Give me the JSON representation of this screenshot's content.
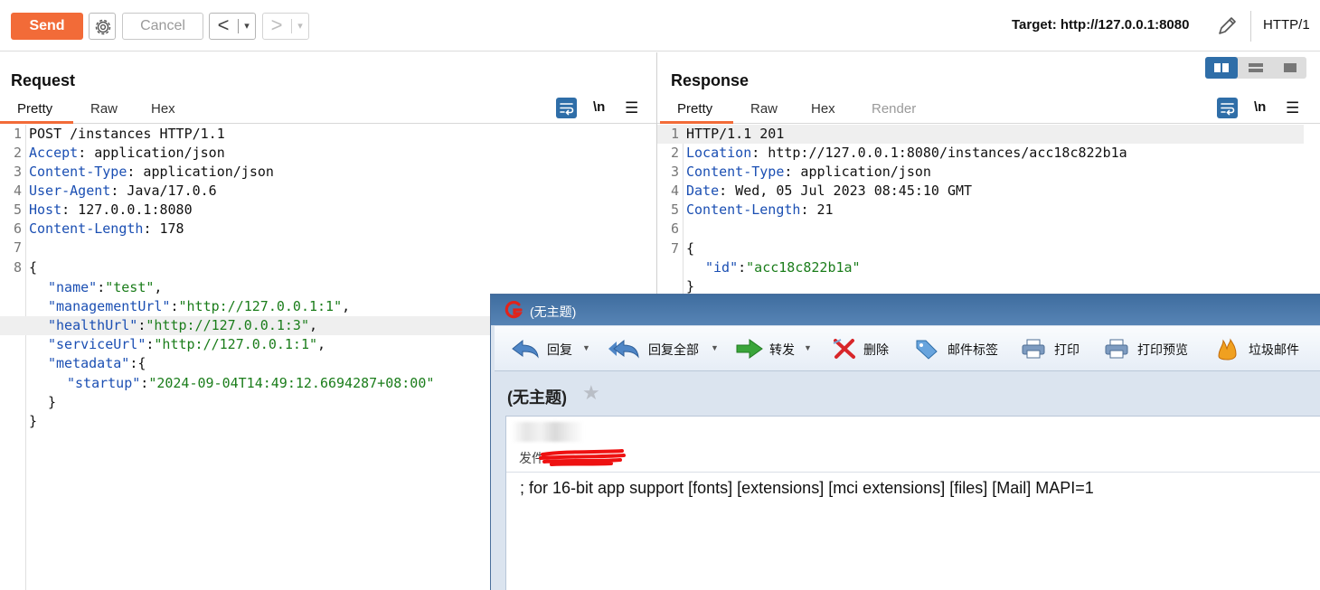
{
  "toolbar": {
    "send_label": "Send",
    "cancel_label": "Cancel",
    "back_arrow": "<",
    "forward_arrow": ">",
    "dropdown_caret": "▾",
    "target_label": "Target: http://127.0.0.1:8080",
    "http_version": "HTTP/1",
    "icons": [
      "gear-icon",
      "pencil-icon"
    ]
  },
  "request": {
    "title": "Request",
    "tabs": [
      "Pretty",
      "Raw",
      "Hex"
    ],
    "active_tab": "Pretty",
    "wrap_symbol": "\\n",
    "menu_symbol": "☰",
    "lines": [
      {
        "n": "1",
        "key": "",
        "rest": "POST /instances HTTP/1.1"
      },
      {
        "n": "2",
        "key": "Accept",
        "rest": ": application/json"
      },
      {
        "n": "3",
        "key": "Content-Type",
        "rest": ": application/json"
      },
      {
        "n": "4",
        "key": "User-Agent",
        "rest": ": Java/17.0.6"
      },
      {
        "n": "5",
        "key": "Host",
        "rest": ": 127.0.0.1:8080"
      },
      {
        "n": "6",
        "key": "Content-Length",
        "rest": ": 178"
      },
      {
        "n": "7",
        "key": "",
        "rest": ""
      },
      {
        "n": "8",
        "key": "",
        "rest": "{"
      }
    ],
    "json_lines": [
      {
        "k": "\"name\"",
        "sep": ":",
        "v": "\"test\"",
        "tail": ","
      },
      {
        "k": "\"managementUrl\"",
        "sep": ":",
        "v": "\"http://127.0.0.1:1\"",
        "tail": ","
      },
      {
        "k": "\"healthUrl\"",
        "sep": ":",
        "v": "\"http://127.0.0.1:3\"",
        "tail": ","
      },
      {
        "k": "\"serviceUrl\"",
        "sep": ":",
        "v": "\"http://127.0.0.1:1\"",
        "tail": ","
      },
      {
        "k": "\"metadata\"",
        "sep": ":{",
        "v": "",
        "tail": ""
      },
      {
        "k": "\"startup\"",
        "sep": ":",
        "v": "\"2024-09-04T14:49:12.6694287+08:00\"",
        "tail": ""
      },
      {
        "k": "",
        "sep": "}",
        "v": "",
        "tail": ""
      },
      {
        "k": "",
        "sep": "}",
        "v": "",
        "tail": ""
      }
    ]
  },
  "response": {
    "title": "Response",
    "tabs": [
      "Pretty",
      "Raw",
      "Hex",
      "Render"
    ],
    "active_tab": "Pretty",
    "wrap_symbol": "\\n",
    "menu_symbol": "☰",
    "lines": [
      {
        "n": "1",
        "key": "",
        "rest": "HTTP/1.1 201"
      },
      {
        "n": "2",
        "key": "Location",
        "rest": ": http://127.0.0.1:8080/instances/acc18c822b1a"
      },
      {
        "n": "3",
        "key": "Content-Type",
        "rest": ": application/json"
      },
      {
        "n": "4",
        "key": "Date",
        "rest": ": Wed, 05 Jul 2023 08:45:10 GMT"
      },
      {
        "n": "5",
        "key": "Content-Length",
        "rest": ": 21"
      },
      {
        "n": "6",
        "key": "",
        "rest": ""
      },
      {
        "n": "7",
        "key": "",
        "rest": "{"
      }
    ],
    "json_lines": [
      {
        "k": "\"id\"",
        "sep": ":",
        "v": "\"acc18c822b1a\"",
        "tail": ""
      },
      {
        "k": "",
        "sep": "}",
        "v": "",
        "tail": ""
      }
    ]
  },
  "mail": {
    "window_title": "(无主题)",
    "toolbar": [
      {
        "label": "回复",
        "icon": "reply-icon",
        "caret": true
      },
      {
        "label": "回复全部",
        "icon": "reply-all-icon",
        "caret": true
      },
      {
        "label": "转发",
        "icon": "forward-icon",
        "caret": true
      },
      {
        "label": "删除",
        "icon": "delete-icon",
        "caret": false
      },
      {
        "label": "邮件标签",
        "icon": "tag-icon",
        "caret": false
      },
      {
        "label": "打印",
        "icon": "print-icon",
        "caret": false
      },
      {
        "label": "打印预览",
        "icon": "print-preview-icon",
        "caret": false
      },
      {
        "label": "垃圾邮件",
        "icon": "spam-icon",
        "caret": false
      }
    ],
    "subject": "(无主题)",
    "star": "★",
    "from_label": "发件",
    "body_text": "; for 16-bit app support [fonts] [extensions] [mci extensions] [files] [Mail] MAPI=1"
  },
  "colors": {
    "accent": "#f26b38",
    "header_key": "#1b4fb3",
    "json_string": "#1b7d1b",
    "toggle_active": "#2f6ea8",
    "mail_titlebar": "#4a77aa"
  }
}
